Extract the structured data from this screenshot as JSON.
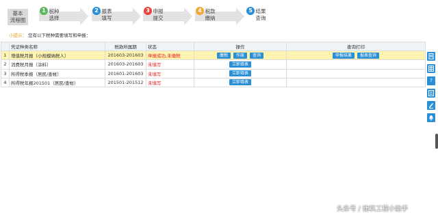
{
  "steps": {
    "home_line1": "基本",
    "home_line2": "流程图",
    "items": [
      {
        "num": "1",
        "line1": "税种",
        "line2": "选择",
        "color": "#5cb85c"
      },
      {
        "num": "2",
        "line1": "报表",
        "line2": "填写",
        "color": "#2a8fd6"
      },
      {
        "num": "3",
        "line1": "申报",
        "line2": "提交",
        "color": "#e8453c"
      },
      {
        "num": "4",
        "line1": "税款",
        "line2": "缴纳",
        "color": "#f0a830"
      },
      {
        "num": "5",
        "line1": "结果",
        "line2": "查询",
        "color": "#2a8fd6"
      }
    ]
  },
  "tip": {
    "label": "小提示：",
    "text": "您有以下税种需要填写和申报："
  },
  "table": {
    "headers": [
      "凭证种类名称",
      "税款所属期",
      "状态",
      "操作",
      "查询打印"
    ],
    "rows": [
      {
        "index": "1",
        "name": "增值税月报（小规模纳税人）",
        "period": "201603-201603",
        "status": "申报成功,未缴税",
        "ops": [
          "缴税",
          "作废",
          "查询"
        ],
        "qp": [
          "申报结果",
          "报表查询"
        ]
      },
      {
        "index": "2",
        "name": "消费税月报（涂料）",
        "period": "201603-201603",
        "status": "未填写",
        "ops": [
          "立即填表"
        ],
        "qp": []
      },
      {
        "index": "3",
        "name": "所得税季报（居民/查帐）",
        "period": "201601-201603",
        "status": "未填写",
        "ops": [
          "立即填表"
        ],
        "qp": []
      },
      {
        "index": "4",
        "name": "所得税年报201501（居民/查帐）",
        "period": "201501-201512",
        "status": "未填写",
        "ops": [
          "立即填表"
        ],
        "qp": []
      }
    ]
  },
  "sidebar": {
    "icons": [
      "document-icon",
      "table-icon",
      "help-icon",
      "list-icon",
      "edit-icon",
      "bell-icon"
    ]
  },
  "watermark": "头条号 / 建筑工程小能手",
  "colors": {
    "accent": "#2a8fd6",
    "highlight_row": "#fff3b0",
    "status_red": "#e8201e"
  }
}
